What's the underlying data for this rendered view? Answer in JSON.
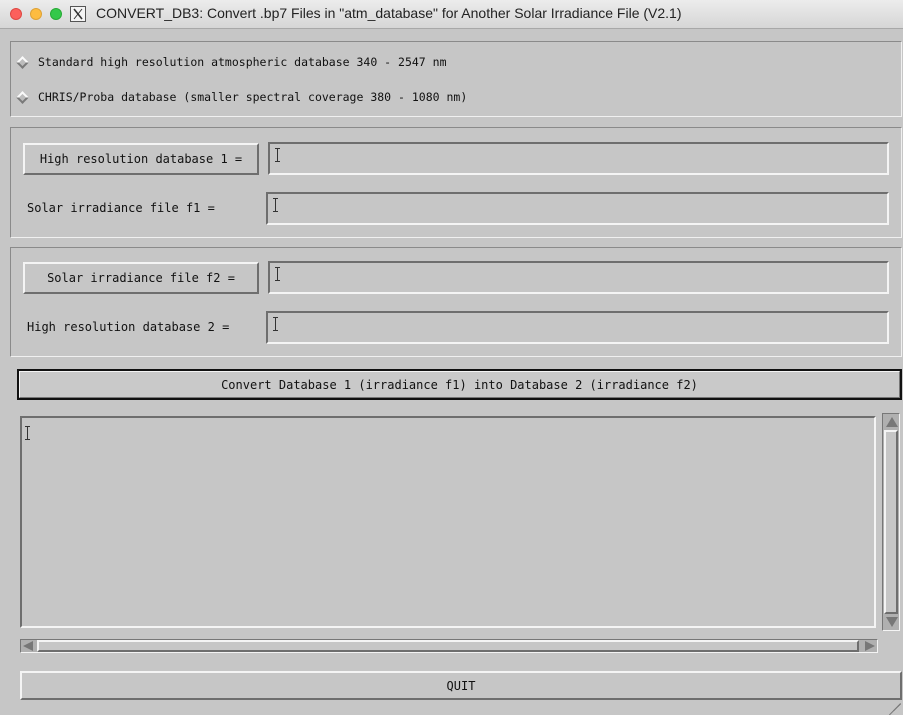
{
  "window": {
    "title": "CONVERT_DB3: Convert .bp7 Files in \"atm_database\" for Another Solar Irradiance File (V2.1)",
    "x11_icon_glyph": "X"
  },
  "database_options": [
    {
      "label": "Standard high resolution atmospheric database 340 - 2547 nm",
      "selected": false
    },
    {
      "label": "CHRIS/Proba database (smaller spectral coverage 380 - 1080 nm)",
      "selected": false
    }
  ],
  "section1": {
    "database1_button": "High resolution database 1 =",
    "database1_value": "",
    "irradiance_f1_label": "Solar irradiance file   f1 =",
    "irradiance_f1_value": ""
  },
  "section2": {
    "irradiance_f2_button": "Solar irradiance file   f2 =",
    "irradiance_f2_value": "",
    "database2_label": "High resolution database 2  =",
    "database2_value": ""
  },
  "convert_button": "Convert Database 1 (irradiance f1) into Database 2 (irradiance f2)",
  "log_text": "",
  "quit_button": "QUIT",
  "icons": [
    "traffic-light-close",
    "traffic-light-minimize",
    "traffic-light-zoom",
    "x11-icon",
    "text-cursor-icon",
    "scroll-arrow-up",
    "scroll-arrow-down",
    "scroll-arrow-left",
    "scroll-arrow-right",
    "resize-grip"
  ]
}
